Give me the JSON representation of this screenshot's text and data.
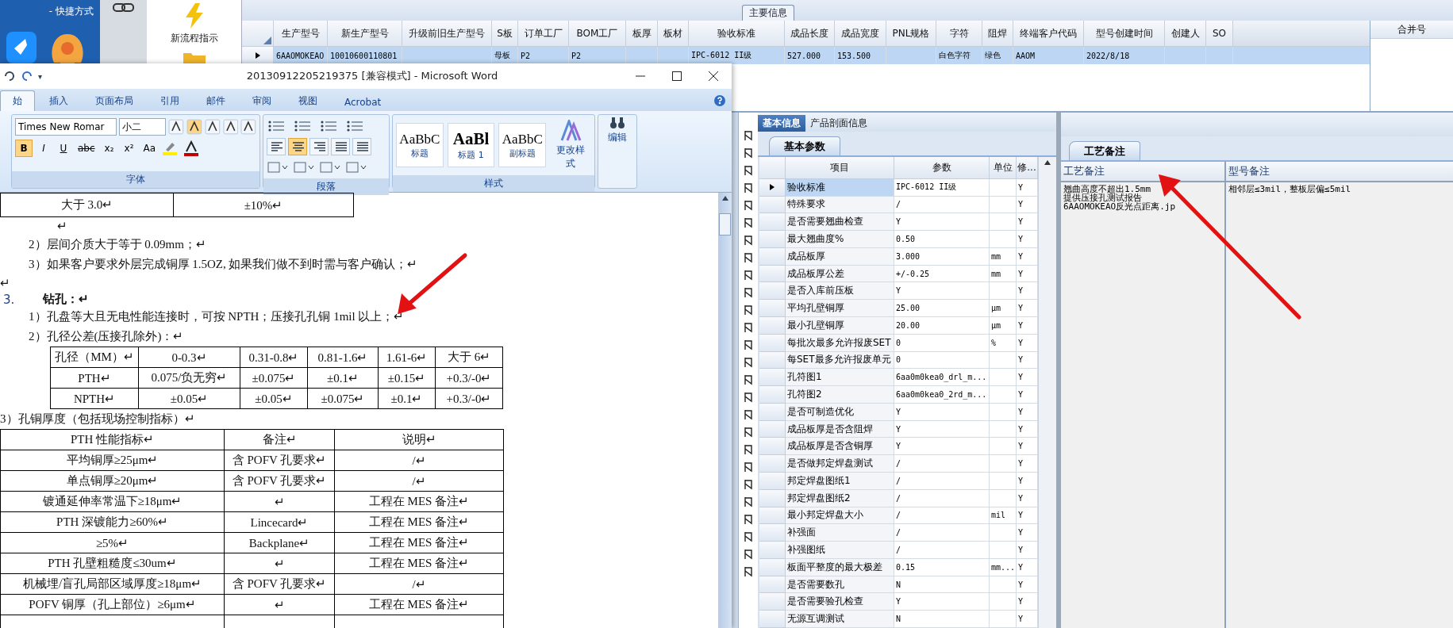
{
  "desktop": {
    "shortcut_caption": "- 快捷方式",
    "launcher_label": "新流程指示"
  },
  "main_grid": {
    "title": "主要信息",
    "columns": [
      "生产型号",
      "新生产型号",
      "升级前旧生产型号",
      "S板",
      "订单工厂",
      "BOM工厂",
      "板厚",
      "板材",
      "验收标准",
      "成品长度",
      "成品宽度",
      "PNL规格",
      "字符",
      "阻焊",
      "终端客户代码",
      "型号创建时间",
      "创建人",
      "SO"
    ],
    "rows": [
      {
        "selected": true,
        "cells": [
          "6AAOMOKEAO",
          "10010600110801",
          "",
          "母板",
          "P2",
          "P2",
          "",
          "",
          "IPC-6012 II级",
          "527.000",
          "153.500",
          "",
          "白色字符",
          "绿色",
          "AAOM",
          "2022/8/18",
          "",
          ""
        ]
      }
    ]
  },
  "merge_panel": {
    "title": "合并号"
  },
  "detail_tabs": [
    {
      "label": "基本信息",
      "selected": true
    },
    {
      "label": "产品剖面信息",
      "selected": false
    }
  ],
  "params": {
    "tab": "基本参数",
    "columns": [
      "项目",
      "参数",
      "单位",
      "修..."
    ],
    "rows": [
      {
        "item": "验收标准",
        "value": "IPC-6012 II级",
        "unit": "",
        "flag": "Y",
        "selected": true
      },
      {
        "item": "特殊要求",
        "value": "/",
        "unit": "",
        "flag": "Y",
        "selected": false
      },
      {
        "item": "是否需要翘曲检查",
        "value": "Y",
        "unit": "",
        "flag": "Y",
        "selected": false
      },
      {
        "item": "最大翘曲度%",
        "value": "0.50",
        "unit": "",
        "flag": "Y",
        "selected": false
      },
      {
        "item": "成品板厚",
        "value": "3.000",
        "unit": "mm",
        "flag": "Y",
        "selected": false
      },
      {
        "item": "成品板厚公差",
        "value": "+/-0.25",
        "unit": "mm",
        "flag": "Y",
        "selected": false
      },
      {
        "item": "是否入库前压板",
        "value": "Y",
        "unit": "",
        "flag": "Y",
        "selected": false
      },
      {
        "item": "平均孔壁铜厚",
        "value": "25.00",
        "unit": "μm",
        "flag": "Y",
        "selected": false
      },
      {
        "item": "最小孔壁铜厚",
        "value": "20.00",
        "unit": "μm",
        "flag": "Y",
        "selected": false
      },
      {
        "item": "每批次最多允许报废SET",
        "value": "0",
        "unit": "%",
        "flag": "Y",
        "selected": false
      },
      {
        "item": "每SET最多允许报废单元",
        "value": "0",
        "unit": "",
        "flag": "Y",
        "selected": false
      },
      {
        "item": "孔符图1",
        "value": "6aa0m0kea0_drl_m...",
        "unit": "",
        "flag": "Y",
        "selected": false
      },
      {
        "item": "孔符图2",
        "value": "6aa0m0kea0_2rd_m...",
        "unit": "",
        "flag": "Y",
        "selected": false
      },
      {
        "item": "是否可制造优化",
        "value": "Y",
        "unit": "",
        "flag": "Y",
        "selected": false
      },
      {
        "item": "成品板厚是否含阻焊",
        "value": "Y",
        "unit": "",
        "flag": "Y",
        "selected": false
      },
      {
        "item": "成品板厚是否含铜厚",
        "value": "Y",
        "unit": "",
        "flag": "Y",
        "selected": false
      },
      {
        "item": "是否做邦定焊盘测试",
        "value": "/",
        "unit": "",
        "flag": "Y",
        "selected": false
      },
      {
        "item": "邦定焊盘图纸1",
        "value": "/",
        "unit": "",
        "flag": "Y",
        "selected": false
      },
      {
        "item": "邦定焊盘图纸2",
        "value": "/",
        "unit": "",
        "flag": "Y",
        "selected": false
      },
      {
        "item": "最小邦定焊盘大小",
        "value": "/",
        "unit": "mil",
        "flag": "Y",
        "selected": false
      },
      {
        "item": "补强面",
        "value": "/",
        "unit": "",
        "flag": "Y",
        "selected": false
      },
      {
        "item": "补强图纸",
        "value": "/",
        "unit": "",
        "flag": "Y",
        "selected": false
      },
      {
        "item": "板面平整度的最大极差",
        "value": "0.15",
        "unit": "mm...",
        "flag": "Y",
        "selected": false
      },
      {
        "item": "是否需要数孔",
        "value": "N",
        "unit": "",
        "flag": "Y",
        "selected": false
      },
      {
        "item": "是否需要验孔检查",
        "value": "Y",
        "unit": "",
        "flag": "Y",
        "selected": false
      },
      {
        "item": "无源互调测试",
        "value": "N",
        "unit": "",
        "flag": "Y",
        "selected": false
      }
    ]
  },
  "notes": {
    "tab": "工艺备注",
    "columns": [
      "工艺备注",
      "型号备注"
    ],
    "process_note": [
      "翘曲高度不超出1.5mm",
      "提供压接孔测试报告",
      "6AAOMOKEAO反光点距离.jp"
    ],
    "model_note": "相邻层≤3mil，整板层偏≤5mil"
  },
  "word": {
    "quick_access_caret": "▾",
    "title": "20130912205219375 [兼容模式] - Microsoft Word",
    "tabs": [
      {
        "label": "始",
        "selected": true
      },
      {
        "label": "插入",
        "selected": false
      },
      {
        "label": "页面布局",
        "selected": false
      },
      {
        "label": "引用",
        "selected": false
      },
      {
        "label": "邮件",
        "selected": false
      },
      {
        "label": "审阅",
        "selected": false
      },
      {
        "label": "视图",
        "selected": false
      },
      {
        "label": "Acrobat",
        "selected": false
      }
    ],
    "font_name": "Times New Romar",
    "font_size": "小二",
    "font_buttons": [
      {
        "label": "B",
        "on": true
      },
      {
        "label": "I",
        "on": false
      },
      {
        "label": "U",
        "on": false
      },
      {
        "label": "abc",
        "on": false
      },
      {
        "label": "x₂",
        "on": false
      },
      {
        "label": "x²",
        "on": false
      },
      {
        "label": "Aa",
        "on": false
      }
    ],
    "align_buttons": [
      {
        "kind": "left",
        "selected": false
      },
      {
        "kind": "center",
        "selected": true
      },
      {
        "kind": "right",
        "selected": false
      },
      {
        "kind": "justify",
        "selected": false
      },
      {
        "kind": "distributed",
        "selected": false
      }
    ],
    "styles": [
      {
        "sample": "AaBbC",
        "label": "标题"
      },
      {
        "sample": "AaBl",
        "label": "标题 1"
      },
      {
        "sample": "AaBbC",
        "label": "副标题"
      }
    ],
    "change_styles": "更改样式",
    "edit": "编辑",
    "groups": [
      "字体",
      "段落",
      "样式"
    ],
    "document": [
      {
        "kind": "narrow",
        "rows": [
          [
            "大于 3.0↵",
            "±10%↵"
          ]
        ]
      },
      {
        "kind": "deep",
        "text": "↵"
      },
      {
        "kind": "item",
        "text": "2）层间介质大于等于 0.09mm；↵"
      },
      {
        "kind": "item",
        "text": "3）如果客户要求外层完成铜厚 1.5OZ, 如果我们做不到时需与客户确认；↵"
      },
      {
        "kind": "plain",
        "text": "↵"
      },
      {
        "kind": "heading",
        "number": "3.",
        "text": "钻孔：↵"
      },
      {
        "kind": "item",
        "text": "1）孔盘等大且无电性能连接时，可按 NPTH；压接孔孔铜 1mil 以上；↵"
      },
      {
        "kind": "item",
        "text": "2）孔径公差(压接孔除外)：↵"
      },
      {
        "kind": "tolerance",
        "rows": [
          [
            "孔径（MM）↵",
            "0-0.3↵",
            "0.31-0.8↵",
            "0.81-1.6↵",
            "1.61-6↵",
            "大于 6↵"
          ],
          [
            "PTH↵",
            "0.075/负无穷↵",
            "±0.075↵",
            "±0.1↵",
            "±0.15↵",
            "+0.3/-0↵"
          ],
          [
            "NPTH↵",
            "±0.05↵",
            "±0.05↵",
            "±0.075↵",
            "±0.1↵",
            "+0.3/-0↵"
          ]
        ]
      },
      {
        "kind": "plain",
        "text": "3）孔铜厚度（包括现场控制指标）↵"
      },
      {
        "kind": "spec",
        "rows": [
          [
            "PTH 性能指标↵",
            "备注↵",
            "说明↵"
          ],
          [
            "平均铜厚≥25μm↵",
            "含 POFV 孔要求↵",
            "/↵"
          ],
          [
            "单点铜厚≥20μm↵",
            "含 POFV 孔要求↵",
            "/↵"
          ],
          [
            "镀通延伸率常温下≥18μm↵",
            "↵",
            "工程在 MES 备注↵"
          ],
          [
            "PTH 深镀能力≥60%↵",
            "Lincecard↵",
            "工程在 MES 备注↵"
          ],
          [
            "≥5%↵",
            "Backplane↵",
            "工程在 MES 备注↵"
          ],
          [
            "PTH 孔壁粗糙度≤30um↵",
            "↵",
            "工程在 MES 备注↵"
          ],
          [
            "机械埋/盲孔局部区域厚度≥18μm↵",
            "含 POFV 孔要求↵",
            "/↵"
          ],
          [
            "POFV 铜厚（孔上部位）≥6μm↵",
            "↵",
            "工程在 MES 备注↵"
          ]
        ]
      }
    ]
  }
}
